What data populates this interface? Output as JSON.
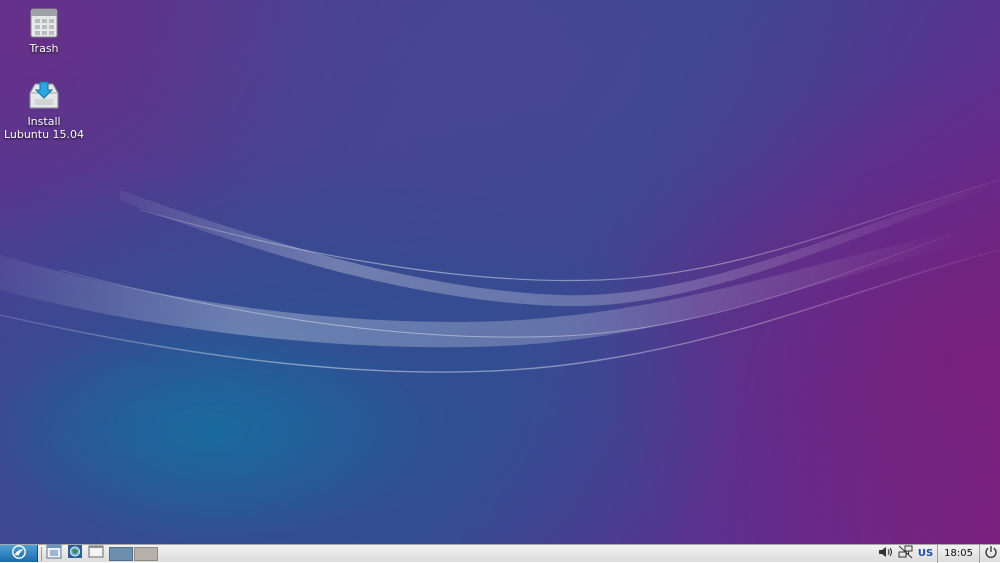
{
  "desktop": {
    "icons": [
      {
        "label": "Trash",
        "icon": "trash-icon"
      },
      {
        "label": "Install\nLubuntu 15.04",
        "icon": "installer-icon"
      }
    ]
  },
  "taskbar": {
    "menu_icon": "lubuntu-menu-icon",
    "launchers": [
      {
        "icon": "file-manager-icon"
      },
      {
        "icon": "web-browser-icon"
      },
      {
        "icon": "show-desktop-icon"
      }
    ],
    "workspaces": [
      {
        "index": 1,
        "active": true
      },
      {
        "index": 2,
        "active": false
      }
    ],
    "tray": {
      "volume_icon": "speaker-icon",
      "network_icon": "network-icon",
      "keyboard_layout": "US",
      "clock": "18:05",
      "power_icon": "power-icon"
    }
  },
  "colors": {
    "wallpaper_blue": "#1b6aa8",
    "wallpaper_purple": "#7a2282",
    "taskbar_bg": "#e6e6e6",
    "kbd_layout_text": "#1c4fa8"
  }
}
